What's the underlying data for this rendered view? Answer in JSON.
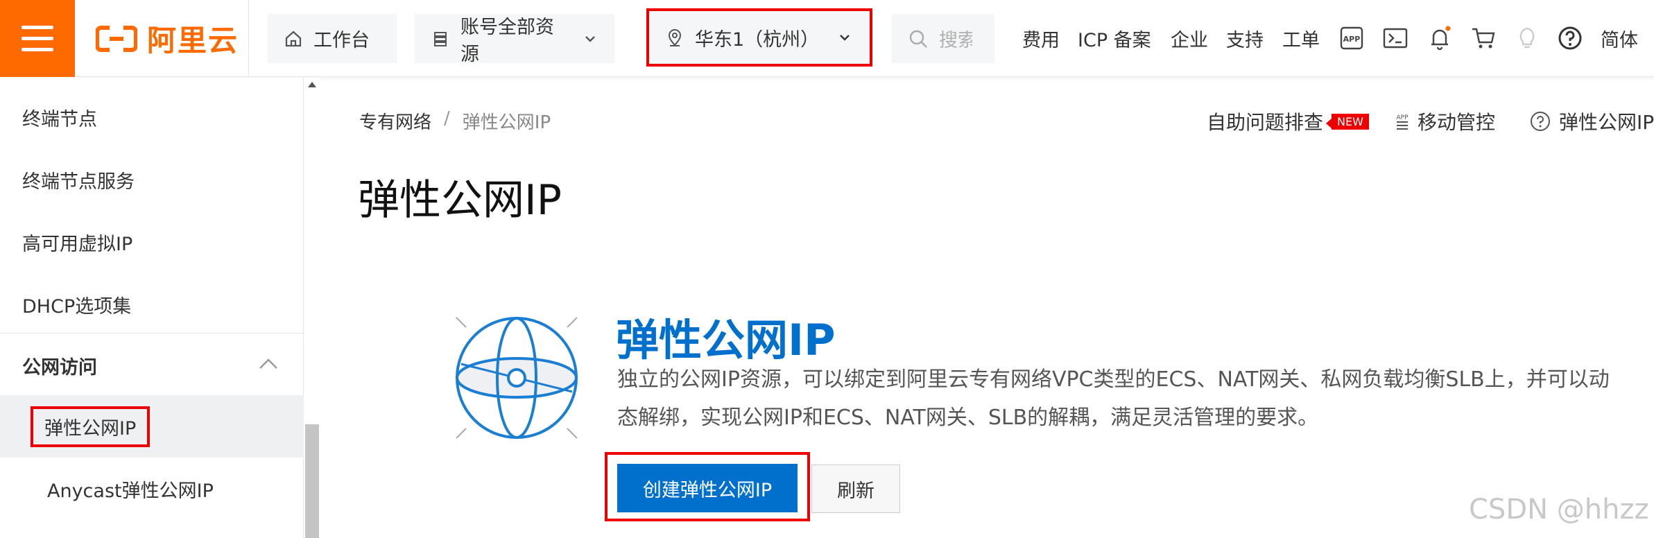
{
  "topbar": {
    "logo_text": "阿里云",
    "home_label": "工作台",
    "account_label": "账号全部资源",
    "region_label": "华东1（杭州）",
    "search_placeholder": "搜索",
    "links": {
      "fees": "费用",
      "icp": "ICP 备案",
      "enterprise": "企业",
      "support": "支持",
      "ticket": "工单",
      "language": "简体"
    },
    "icons": [
      "app-icon",
      "terminal-icon",
      "bell-icon",
      "cart-icon",
      "lightbulb-icon",
      "help-icon"
    ],
    "accent_color": "#ff6a00"
  },
  "sidebar": {
    "items": [
      {
        "label": "终端节点"
      },
      {
        "label": "终端节点服务"
      },
      {
        "label": "高可用虚拟IP"
      },
      {
        "label": "DHCP选项集"
      }
    ],
    "group": {
      "label": "公网访问",
      "expanded": true
    },
    "sub_items": [
      {
        "label": "弹性公网IP",
        "active": true
      },
      {
        "label": "Anycast弹性公网IP"
      }
    ]
  },
  "main": {
    "breadcrumb": {
      "parent": "专有网络",
      "separator": "/",
      "current": "弹性公网IP"
    },
    "title": "弹性公网IP",
    "header_actions": {
      "troubleshoot": "自助问题排查",
      "new_badge": "NEW",
      "mobile": "移动管控",
      "doc": "弹性公网IP"
    },
    "hero": {
      "title": "弹性公网IP",
      "desc_line1": "独立的公网IP资源，可以绑定到阿里云专有网络VPC类型的ECS、NAT网关、私网负载均衡SLB上，并可以动",
      "desc_line2": "态解绑，实现公网IP和ECS、NAT网关、SLB的解耦，满足灵活管理的要求。",
      "create_button": "创建弹性公网IP",
      "refresh_button": "刷新",
      "primary_color": "#0070cc"
    }
  },
  "watermark": "CSDN @hhzz"
}
